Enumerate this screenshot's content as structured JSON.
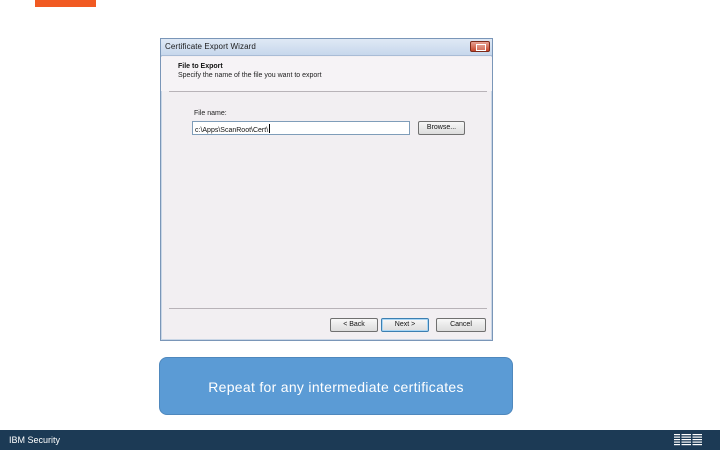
{
  "dialog": {
    "title": "Certificate Export Wizard",
    "section_title": "File to Export",
    "section_desc": "Specify the name of the file you want to export",
    "field_label": "File name:",
    "filename_value": "c:\\Apps\\ScanRoot\\Cert\\",
    "browse_label": "Browse...",
    "back_label": "< Back",
    "next_label": "Next >",
    "cancel_label": "Cancel"
  },
  "caption": {
    "text": "Repeat for any intermediate certificates"
  },
  "footer": {
    "text": "IBM Security",
    "logo": "IBM"
  },
  "colors": {
    "accent": "#f15a22",
    "caption_bg": "#5b9bd5",
    "footer_bg": "#1c3a55"
  }
}
